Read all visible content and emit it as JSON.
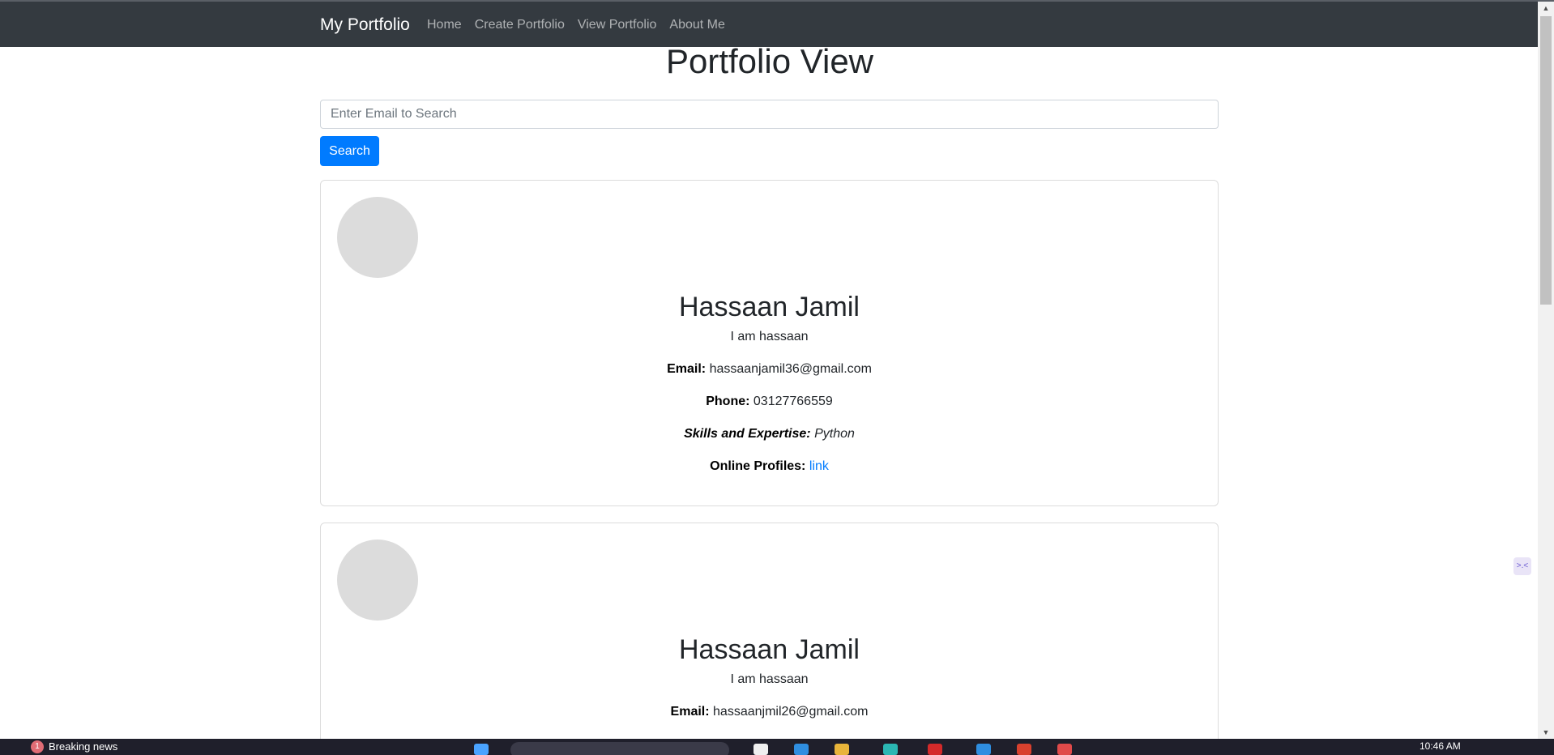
{
  "navbar": {
    "brand": "My Portfolio",
    "links": [
      "Home",
      "Create Portfolio",
      "View Portfolio",
      "About Me"
    ]
  },
  "page": {
    "title": "Portfolio View",
    "search_placeholder": "Enter Email to Search",
    "search_button": "Search"
  },
  "portfolios": [
    {
      "name": "Hassaan Jamil",
      "bio": "I am hassaan",
      "email_label": "Email:",
      "email": "hassaanjamil36@gmail.com",
      "phone_label": "Phone:",
      "phone": "03127766559",
      "skills_label": "Skills and Expertise:",
      "skills": "Python",
      "profiles_label": "Online Profiles:",
      "profiles_link": "link"
    },
    {
      "name": "Hassaan Jamil",
      "bio": "I am hassaan",
      "email_label": "Email:",
      "email": "hassaanjmil26@gmail.com"
    }
  ],
  "taskbar": {
    "news_count": "1",
    "news_text": "Breaking news",
    "time": "10:46 AM"
  },
  "colors": {
    "navbar_bg": "#343a40",
    "primary": "#007bff"
  }
}
